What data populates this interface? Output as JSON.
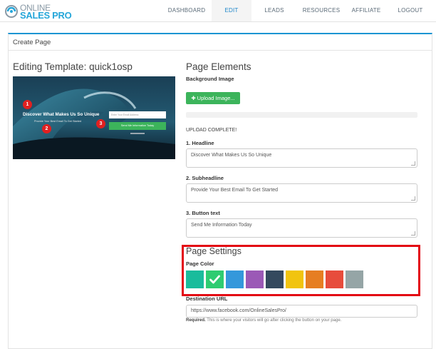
{
  "brand": {
    "line1": "ONLINE",
    "line2": "SALES PRO"
  },
  "nav": [
    {
      "label": "DASHBOARD",
      "active": false
    },
    {
      "label": "EDIT",
      "active": true
    },
    {
      "label": "LEADS",
      "active": false
    },
    {
      "label": "RESOURCES",
      "active": false
    },
    {
      "label": "AFFILIATE",
      "active": false
    },
    {
      "label": "LOGOUT",
      "active": false
    }
  ],
  "panel": {
    "title": "Create Page"
  },
  "editor": {
    "heading": "Editing Template: quick1osp",
    "preview": {
      "headline": "Discover What Makes Us So Unique",
      "subheadline": "Provide Your Best Email To Get Started",
      "email_placeholder": "Enter Your Email Address",
      "button": "Send Me Information Today",
      "badges": [
        "1",
        "2",
        "3"
      ]
    }
  },
  "elements": {
    "heading": "Page Elements",
    "background_label": "Background Image",
    "upload_button": "Upload Image...",
    "upload_icon": "plus-icon",
    "upload_status": "UPLOAD COMPLETE!",
    "headline_label": "1. Headline",
    "headline_value": "Discover What Makes Us So Unique",
    "subheadline_label": "2. Subheadline",
    "subheadline_value": "Provide Your Best Email To Get Started",
    "button_label": "3. Button text",
    "button_value": "Send Me Information Today"
  },
  "settings": {
    "heading": "Page Settings",
    "color_label": "Page Color",
    "selected_index": 1,
    "selected_icon": "checkmark-icon",
    "colors": [
      "#1abc9c",
      "#2ecc71",
      "#3498db",
      "#9b59b6",
      "#34495e",
      "#f1c40f",
      "#e67e22",
      "#e74c3c",
      "#95a5a6"
    ],
    "highlight_color": "#e30613"
  },
  "destination": {
    "label": "Destination URL",
    "value": "https://www.facebook.com/OnlineSalesPro/",
    "help_bold": "Required.",
    "help_text": " This is where your visitors will go after clicking the button on your page."
  }
}
